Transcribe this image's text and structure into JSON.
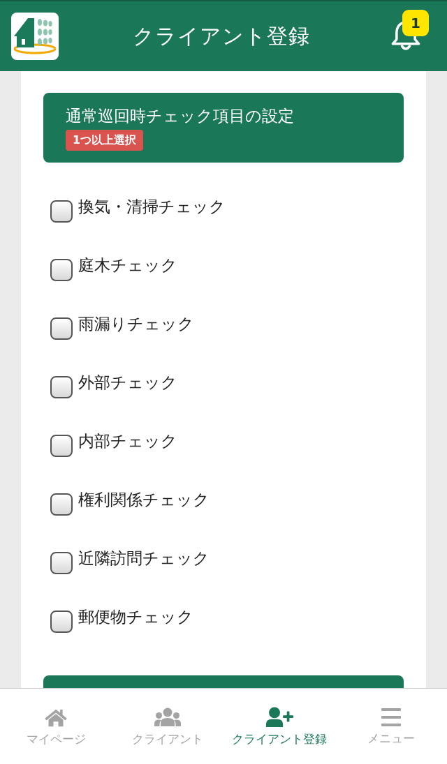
{
  "header": {
    "title": "クライアント登録",
    "notification_count": "1"
  },
  "section": {
    "title": "通常巡回時チェック項目の設定",
    "badge": "1つ以上選択"
  },
  "check_items": [
    {
      "label": "換気・清掃チェック",
      "checked": false
    },
    {
      "label": "庭木チェック",
      "checked": false
    },
    {
      "label": "雨漏りチェック",
      "checked": false
    },
    {
      "label": "外部チェック",
      "checked": false
    },
    {
      "label": "内部チェック",
      "checked": false
    },
    {
      "label": "権利関係チェック",
      "checked": false
    },
    {
      "label": "近隣訪問チェック",
      "checked": false
    },
    {
      "label": "郵便物チェック",
      "checked": false
    }
  ],
  "bottom_nav": [
    {
      "label": "マイページ",
      "kind": "home",
      "selected": false
    },
    {
      "label": "クライアント",
      "kind": "users",
      "selected": false
    },
    {
      "label": "クライアント登録",
      "kind": "user-plus",
      "selected": true
    },
    {
      "label": "メニュー",
      "kind": "menu",
      "selected": false
    }
  ]
}
